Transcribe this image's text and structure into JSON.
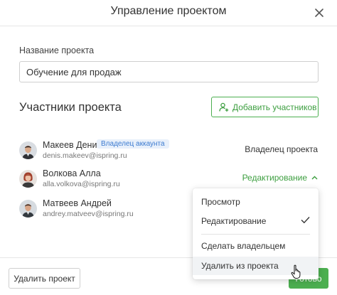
{
  "dialog": {
    "title": "Управление проектом"
  },
  "project": {
    "name_label": "Название проекта",
    "name_value": "Обучение для продаж"
  },
  "members_section": {
    "title": "Участники проекта",
    "add_button_label": "Добавить участников"
  },
  "members": [
    {
      "name": "Макеев Денис",
      "email": "denis.makeev@ispring.ru",
      "badge": "Владелец аккаунта",
      "role": "Владелец проекта"
    },
    {
      "name": "Волкова Алла",
      "email": "alla.volkova@ispring.ru",
      "role": "Редактирование"
    },
    {
      "name": "Матвеев Андрей",
      "email": "andrey.matveev@ispring.ru"
    }
  ],
  "role_menu": {
    "items": [
      {
        "label": "Просмотр"
      },
      {
        "label": "Редактирование",
        "checked": true
      },
      {
        "label": "Сделать владельцем"
      },
      {
        "label": "Удалить из проекта",
        "hovered": true
      }
    ]
  },
  "footer": {
    "delete_label": "Удалить проект",
    "done_label": "Готово"
  },
  "colors": {
    "accent_green": "#4caf50",
    "badge_blue": "#3d7bd0"
  }
}
